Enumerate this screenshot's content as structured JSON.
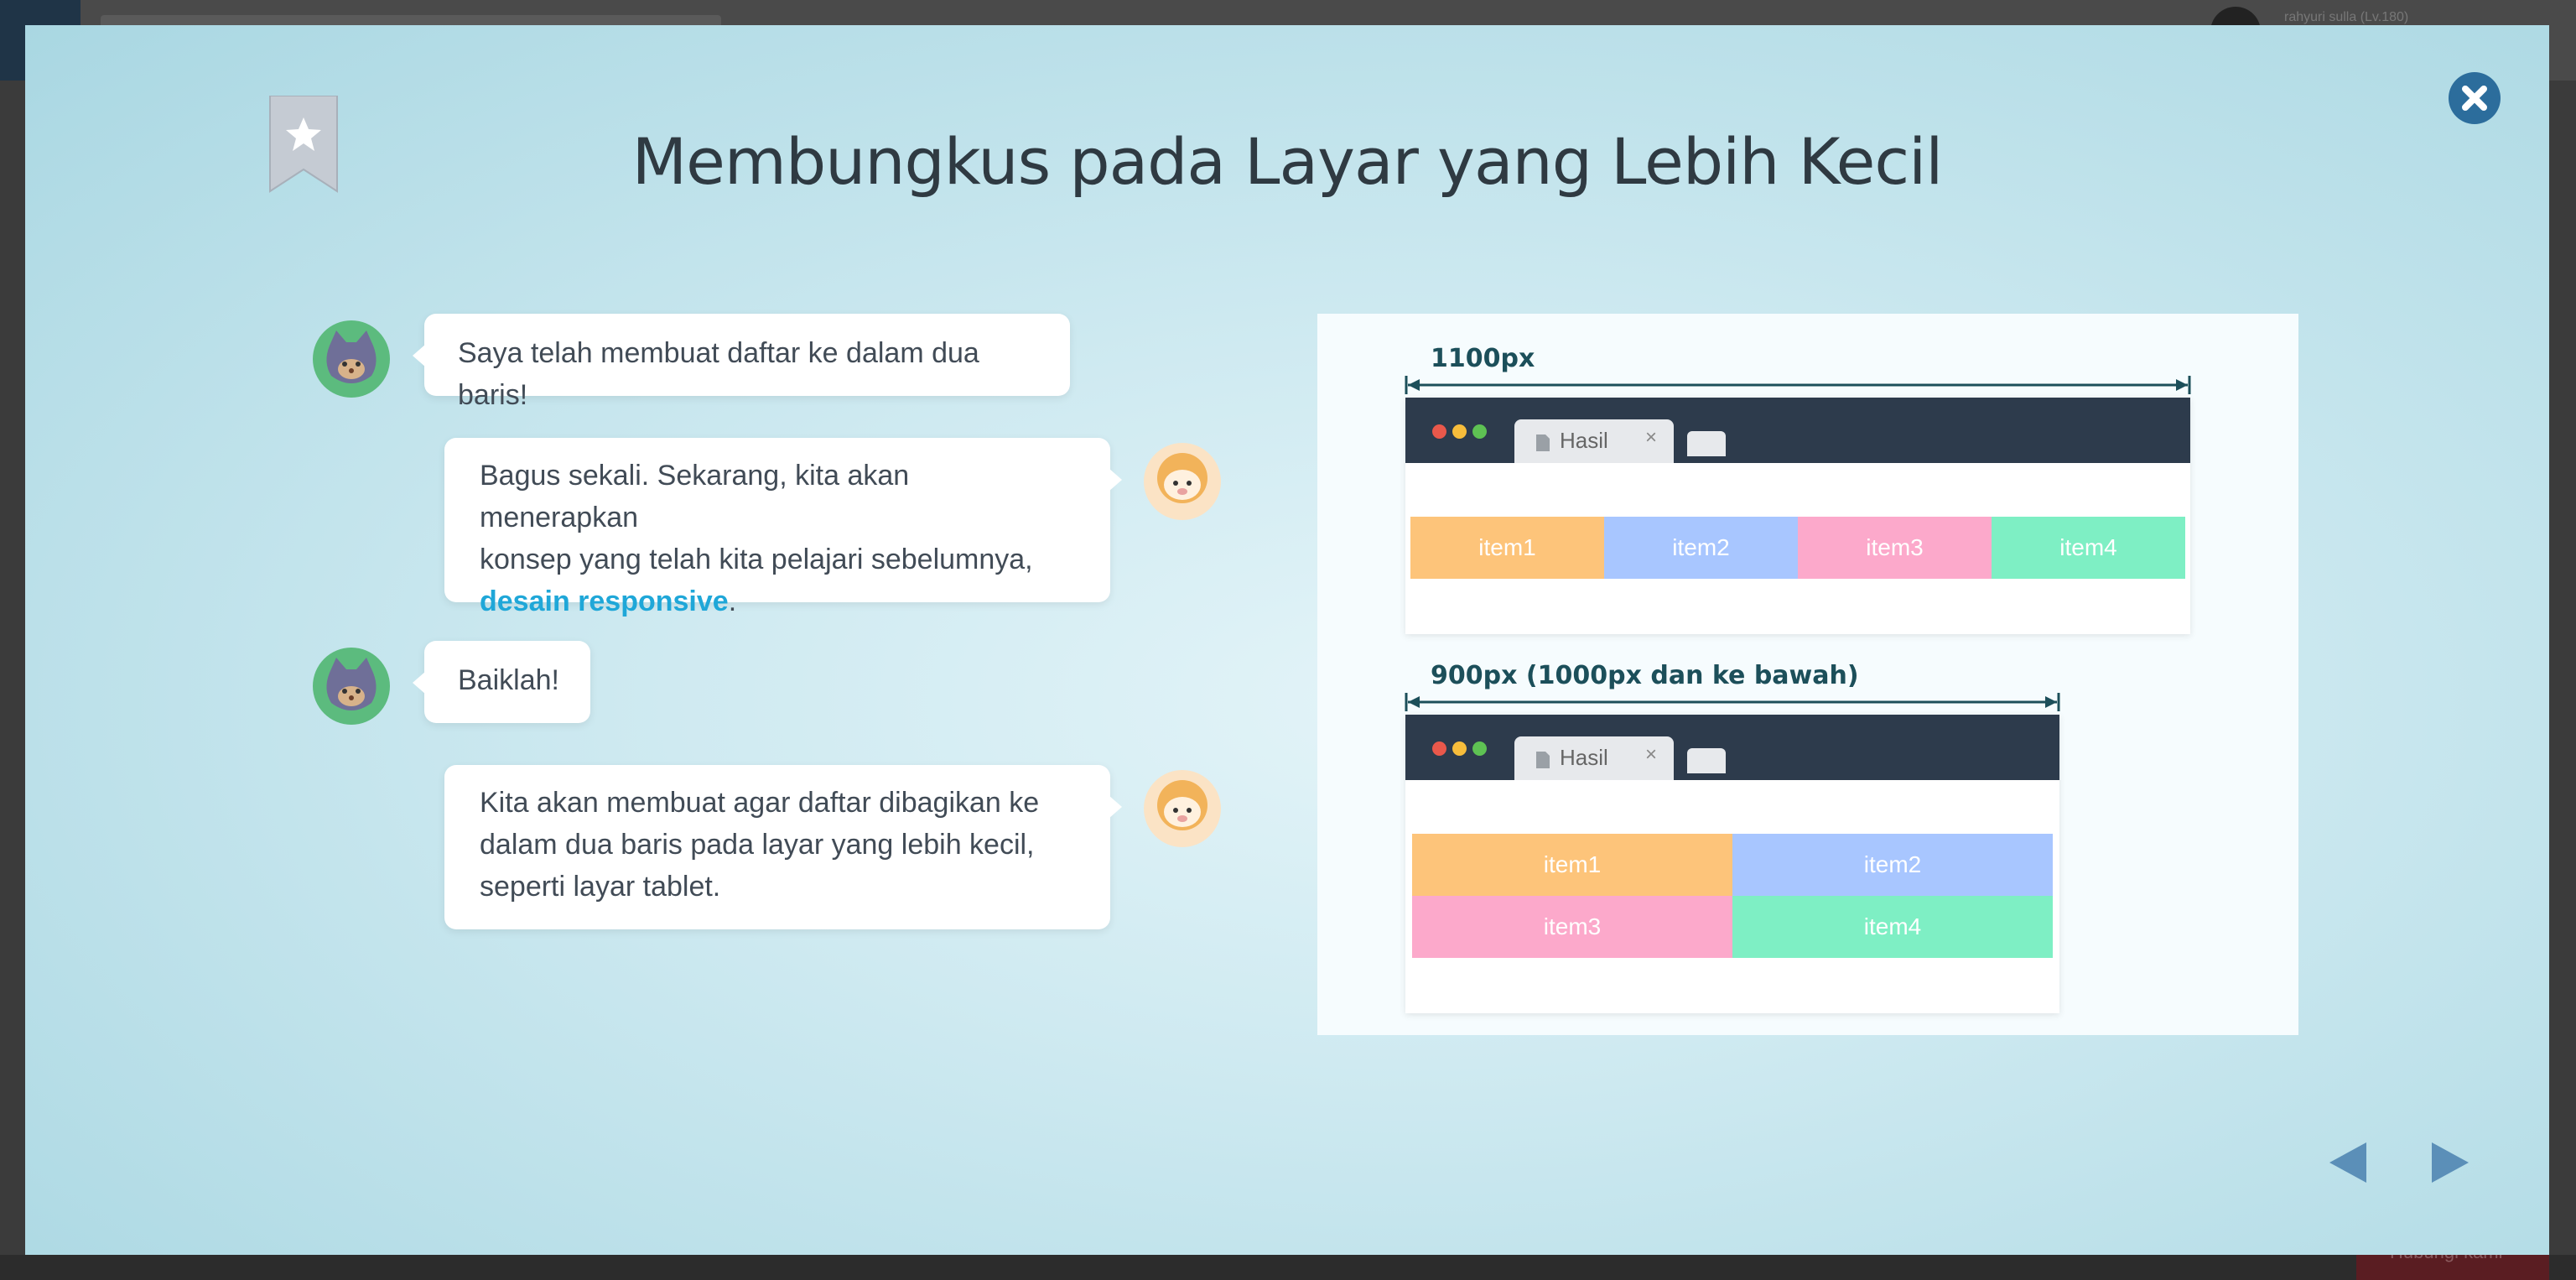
{
  "background": {
    "user_label": "rahyuri sulla (Lv.180)",
    "bottom_button_label": "Hubungi kami"
  },
  "modal": {
    "title": "Membungkus pada Layar yang Lebih Kecil",
    "colors": {
      "accent": "#1fa7d8",
      "close": "#2c6d9c",
      "nav_arrow": "#5b8fb8"
    }
  },
  "dialogue": [
    {
      "speaker": "cat",
      "text": "Saya telah membuat daftar ke dalam dua baris!"
    },
    {
      "speaker": "sheep",
      "text_line1": "Bagus sekali. Sekarang, kita akan menerapkan",
      "text_line2": "konsep yang telah kita pelajari sebelumnya,",
      "highlight": "desain responsive",
      "suffix": "."
    },
    {
      "speaker": "cat",
      "text": "Baiklah!"
    },
    {
      "speaker": "sheep",
      "text_line1": "Kita akan membuat agar daftar dibagikan ke",
      "text_line2": "dalam dua baris pada layar yang lebih kecil,",
      "text_line3": "seperti layar tablet."
    }
  ],
  "illustration": {
    "wide": {
      "width_label": "1100px",
      "tab_label": "Hasil",
      "tab_close": "×",
      "items": [
        "item1",
        "item2",
        "item3",
        "item4"
      ]
    },
    "narrow": {
      "width_label": "900px (1000px dan ke bawah)",
      "tab_label": "Hasil",
      "tab_close": "×",
      "items": [
        "item1",
        "item2",
        "item3",
        "item4"
      ]
    },
    "item_colors": [
      "#fdc47a",
      "#a8c6ff",
      "#fca9cb",
      "#7eefc4"
    ]
  }
}
